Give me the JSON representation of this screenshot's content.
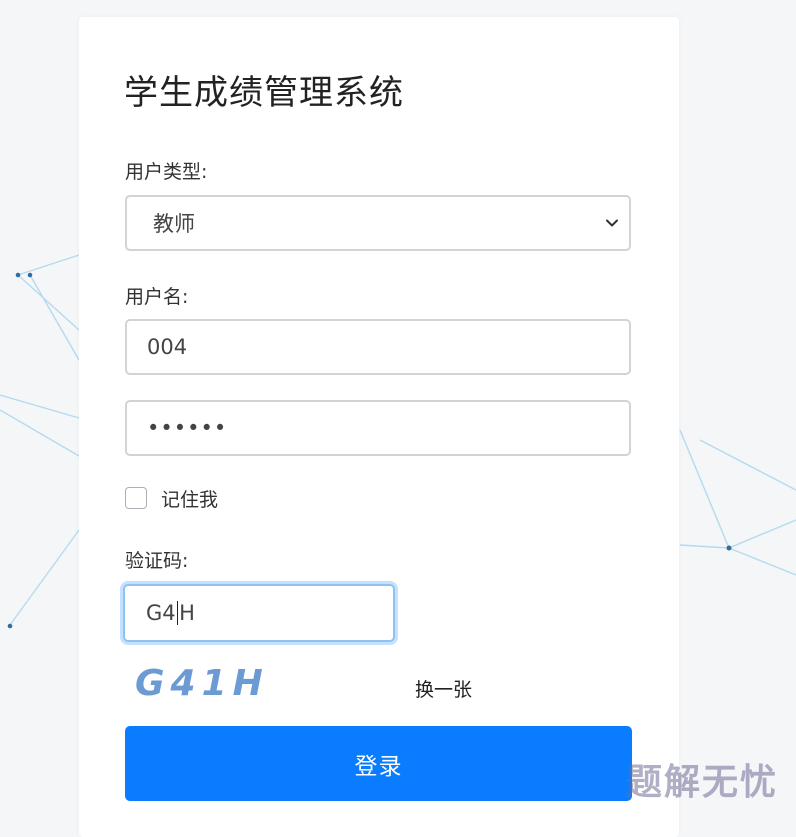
{
  "app": {
    "title": "学生成绩管理系统"
  },
  "form": {
    "user_type_label": "用户类型:",
    "user_type_value": "教师",
    "username_label": "用户名:",
    "username_value": "004",
    "password_value": "••••••",
    "remember_label": "记住我",
    "remember_checked": false,
    "captcha_label": "验证码:",
    "captcha_value_before_caret": "G4",
    "captcha_value_after_caret": "H",
    "captcha_image_text": "G41H",
    "refresh_captcha_label": "换一张",
    "login_label": "登录"
  },
  "watermark": {
    "text": "题解无忧"
  },
  "colors": {
    "accent": "#0a7cff",
    "focus_border": "#8cc4ef",
    "captcha_text": "#6b9bd2",
    "network_line": "#a9d6ee",
    "network_node": "#2f6f9e"
  },
  "icons": {
    "select_arrow": "chevron-down-icon"
  }
}
